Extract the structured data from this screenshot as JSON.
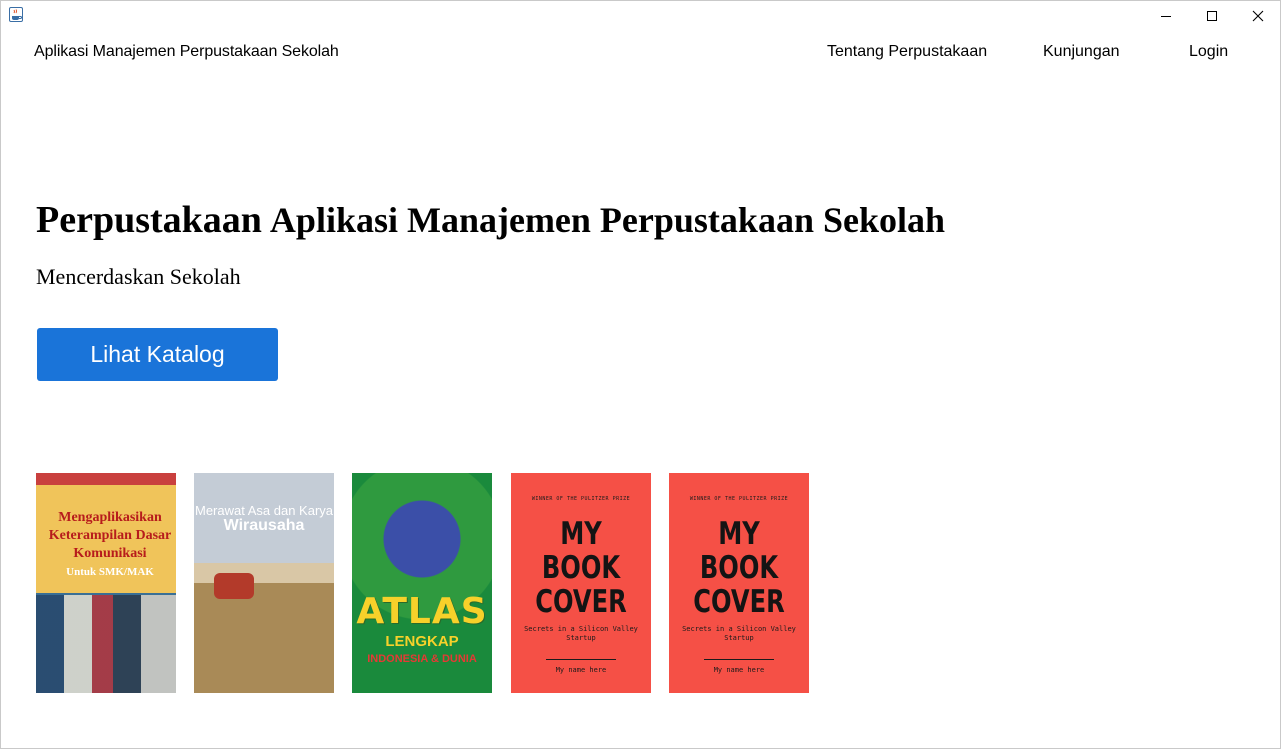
{
  "window": {
    "controls": {
      "minimize_icon": "minimize-icon",
      "maximize_icon": "maximize-icon",
      "close_icon": "close-icon"
    },
    "app_icon": "java-coffee-icon"
  },
  "nav": {
    "brand": "Aplikasi Manajemen Perpustakaan Sekolah",
    "links": [
      "Tentang Perpustakaan",
      "Kunjungan",
      "Login"
    ]
  },
  "hero": {
    "title_part1": "Perpustakaan",
    "title_part2": "Aplikasi Manajemen Perpustakaan Sekolah",
    "subtitle": "Mencerdaskan Sekolah",
    "cta_label": "Lihat Katalog",
    "cta_color": "#1a74d9"
  },
  "books": [
    {
      "title": "Mengaplikasikan Keterampilan Dasar Komunikasi",
      "subtitle": "Untuk SMK/MAK"
    },
    {
      "title_small": "Merawat Asa dan Karya",
      "title_big": "Wirausaha"
    },
    {
      "title": "ATLAS",
      "subtitle": "LENGKAP",
      "tagline": "INDONESIA & DUNIA"
    },
    {
      "top": "WINNER OF THE PULITZER PRIZE",
      "title": "MY BOOK COVER",
      "subtitle": "Secrets in a Silicon Valley Startup",
      "author": "My name here",
      "cover_color": "#f55046"
    },
    {
      "top": "WINNER OF THE PULITZER PRIZE",
      "title": "MY BOOK COVER",
      "subtitle": "Secrets in a Silicon Valley Startup",
      "author": "My name here",
      "cover_color": "#f55046"
    }
  ]
}
